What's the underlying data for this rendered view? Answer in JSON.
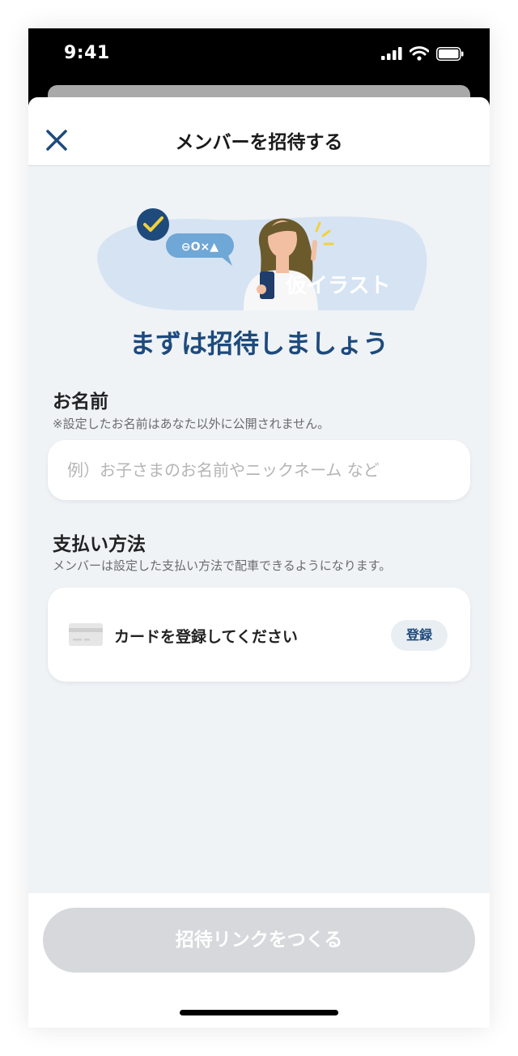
{
  "status_bar": {
    "time": "9:41"
  },
  "header": {
    "title": "メンバーを招待する"
  },
  "illustration": {
    "label": "仮イラスト",
    "chip_text": "⊖O×▲"
  },
  "hero": {
    "title": "まずは招待しましょう"
  },
  "name_section": {
    "title": "お名前",
    "note": "※設定したお名前はあなた以外に公開されません。",
    "input_value": "",
    "placeholder": "例）お子さまのお名前やニックネーム など"
  },
  "payment_section": {
    "title": "支払い方法",
    "note": "メンバーは設定した支払い方法で配車できるようになります。",
    "card_text": "カードを登録してください",
    "register_label": "登録"
  },
  "footer": {
    "cta_label": "招待リンクをつくる"
  },
  "colors": {
    "accent": "#1e4a7c",
    "background": "#eff3f6",
    "disabled_button": "#d6d8db",
    "check_yellow": "#f2d23b"
  }
}
